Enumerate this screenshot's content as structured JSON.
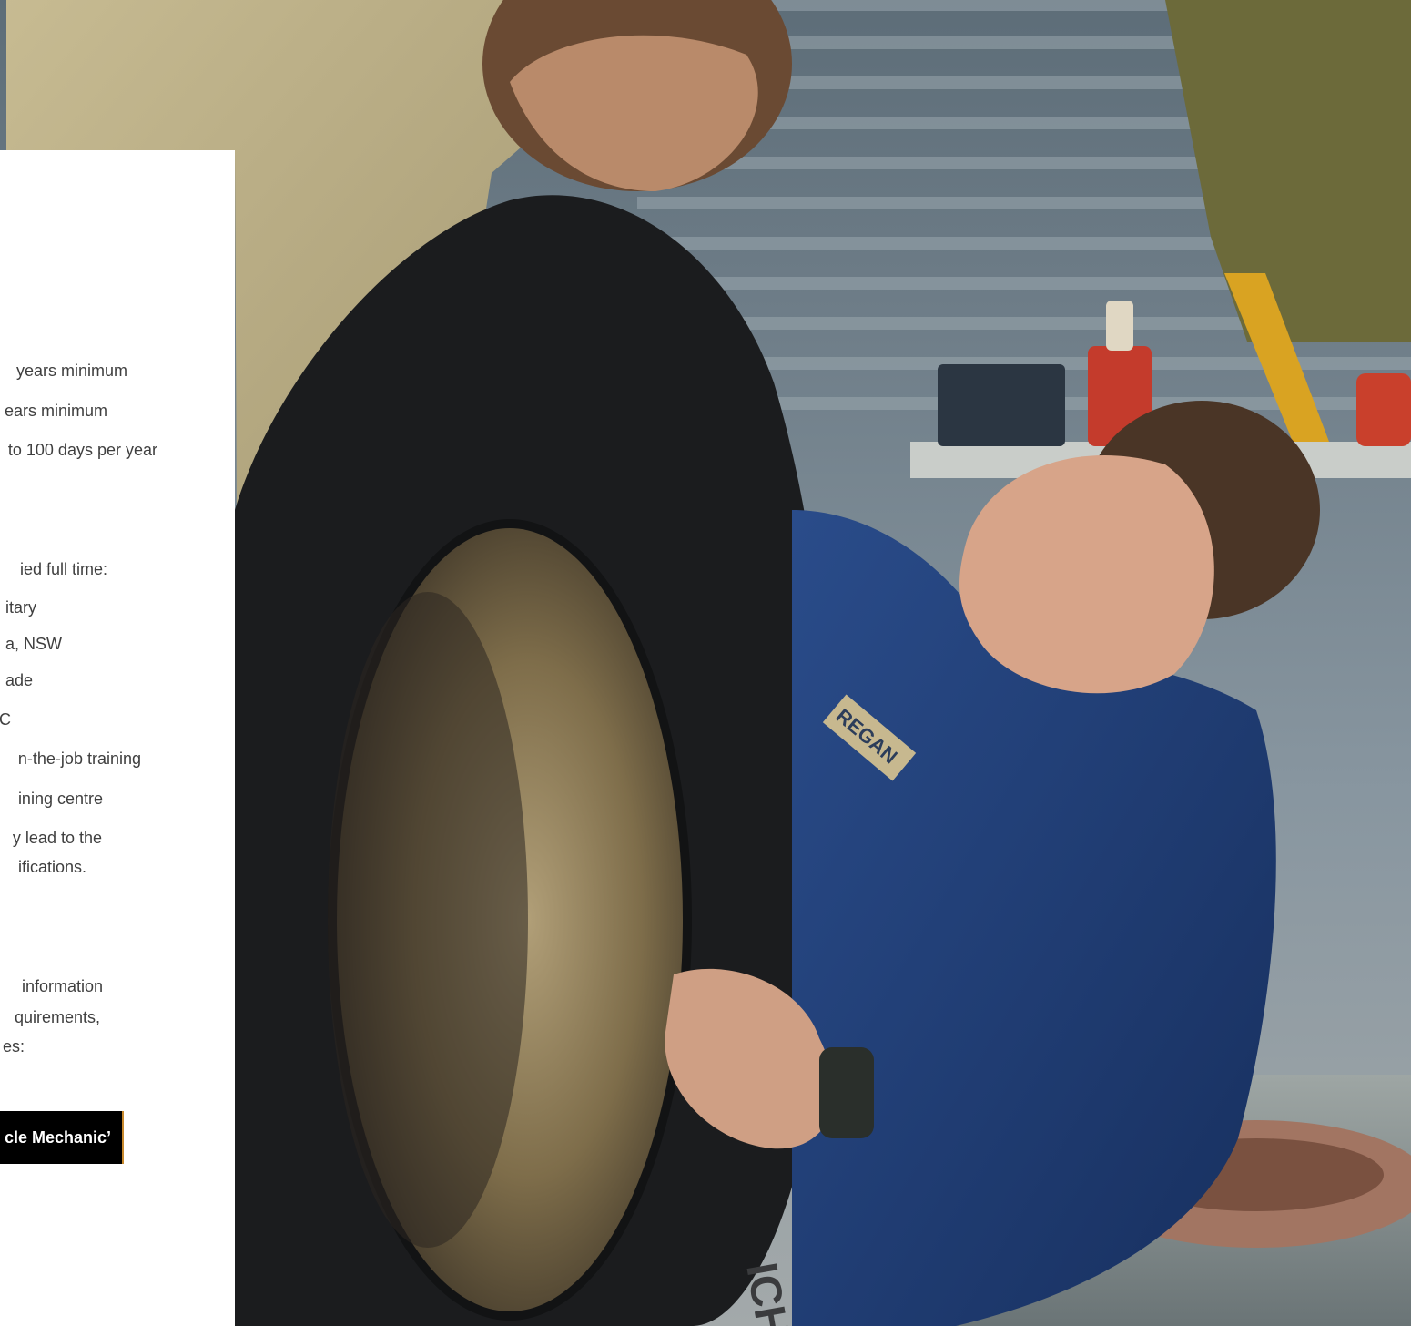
{
  "card": {
    "service_lines": [
      "years minimum",
      "ears minimum",
      "to 100 days per year"
    ],
    "role_lines": [
      "ied full time:",
      "itary",
      "a, NSW",
      "ade",
      "C",
      "n-the-job training",
      "ining centre",
      "y lead to the",
      "ifications."
    ],
    "info_lines": [
      "information",
      "quirements,",
      "es:"
    ],
    "cta_label": "cle Mechanic’"
  },
  "photo": {
    "name_patch": "REGAN",
    "tyre_lettering": "ICH",
    "colors": {
      "shirt_khaki": "#b9ac82",
      "shirt_blue": "#22407a",
      "tyre": "#1b1c1e",
      "rim": "#8a7a55",
      "wall": "#6d7f8a",
      "cta_accent": "#c98a2e"
    }
  }
}
